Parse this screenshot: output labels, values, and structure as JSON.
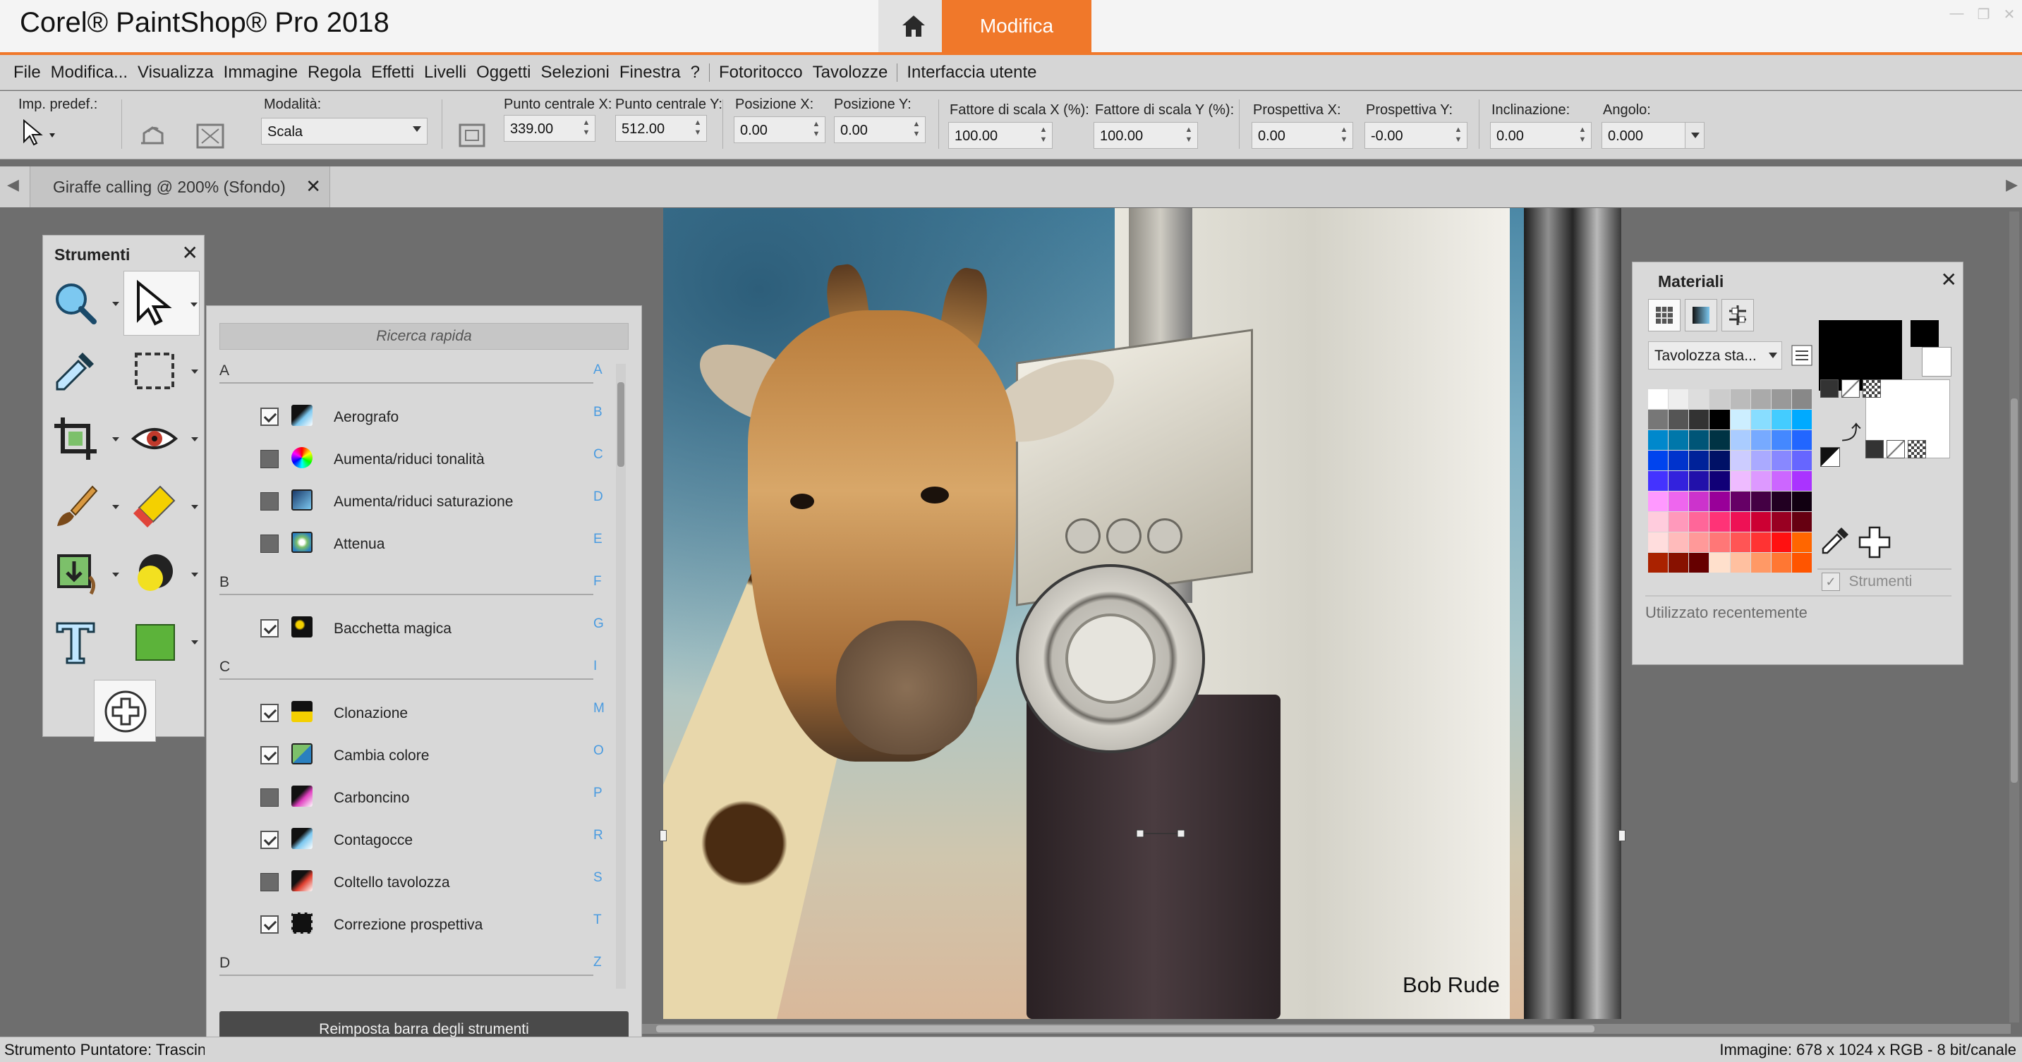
{
  "app": {
    "title": "Corel® PaintShop® Pro 2018",
    "workspace_tab": "Modifica"
  },
  "menu": [
    "File",
    "Modifica...",
    "Visualizza",
    "Immagine",
    "Regola",
    "Effetti",
    "Livelli",
    "Oggetti",
    "Selezioni",
    "Finestra",
    "?",
    "Fotoritocco",
    "Tavolozze",
    "Interfaccia utente"
  ],
  "tool_options": {
    "preset_label": "Imp. predef.:",
    "mode_label": "Modalità:",
    "mode_value": "Scala",
    "fields": [
      {
        "label": "Punto centrale X:",
        "value": "339.00"
      },
      {
        "label": "Punto centrale Y:",
        "value": "512.00"
      },
      {
        "label": "Posizione X:",
        "value": "0.00"
      },
      {
        "label": "Posizione Y:",
        "value": "0.00"
      },
      {
        "label": "Fattore di scala X (%):",
        "value": "100.00"
      },
      {
        "label": "Fattore di scala Y (%):",
        "value": "100.00"
      },
      {
        "label": "Prospettiva X:",
        "value": "0.00"
      },
      {
        "label": "Prospettiva Y:",
        "value": "-0.00"
      },
      {
        "label": "Inclinazione:",
        "value": "0.00"
      },
      {
        "label": "Angolo:",
        "value": "0.000"
      }
    ]
  },
  "document_tab": {
    "label": "Giraffe calling @ 200% (Sfondo)"
  },
  "tools_palette": {
    "title": "Strumenti"
  },
  "customize_panel": {
    "search_placeholder": "Ricerca rapida",
    "alphabet": [
      "A",
      "B",
      "C",
      "D",
      "E",
      "F",
      "G",
      "I",
      "M",
      "O",
      "P",
      "R",
      "S",
      "T",
      "Z"
    ],
    "sections": [
      {
        "letter": "A",
        "items": [
          {
            "label": "Aerografo",
            "checked": true
          },
          {
            "label": "Aumenta/riduci tonalità",
            "checked": false
          },
          {
            "label": "Aumenta/riduci saturazione",
            "checked": false
          },
          {
            "label": "Attenua",
            "checked": false
          }
        ]
      },
      {
        "letter": "B",
        "items": [
          {
            "label": "Bacchetta magica",
            "checked": true
          }
        ]
      },
      {
        "letter": "C",
        "items": [
          {
            "label": "Clonazione",
            "checked": true
          },
          {
            "label": "Cambia colore",
            "checked": true
          },
          {
            "label": "Carboncino",
            "checked": false
          },
          {
            "label": "Contagocce",
            "checked": true
          },
          {
            "label": "Coltello tavolozza",
            "checked": false
          },
          {
            "label": "Correzione prospettiva",
            "checked": true
          }
        ]
      },
      {
        "letter": "D",
        "items": []
      }
    ],
    "reset_button": "Reimposta barra degli strumenti"
  },
  "canvas": {
    "signature": "Bob Rude"
  },
  "materials": {
    "title": "Materiali",
    "swatch_dropdown": "Tavolozza sta...",
    "tools_checkbox": "Strumenti",
    "recent_label": "Utilizzato recentemente",
    "swatch_rows": [
      [
        "#ffffff",
        "#eeeeee",
        "#dddddd",
        "#cccccc",
        "#bbbbbb",
        "#aaaaaa",
        "#999999",
        "#888888"
      ],
      [
        "#777777",
        "#555555",
        "#333333",
        "#000000",
        "#cceeff",
        "#88ddff",
        "#44ccff",
        "#00aaff"
      ],
      [
        "#0088cc",
        "#0077aa",
        "#005577",
        "#003344",
        "#aaccff",
        "#77aaff",
        "#4488ff",
        "#2266ff"
      ],
      [
        "#0044ee",
        "#0033cc",
        "#002299",
        "#001166",
        "#ccccff",
        "#aaaaff",
        "#8888ff",
        "#6666ff"
      ],
      [
        "#4433ff",
        "#3322dd",
        "#2211aa",
        "#110077",
        "#eebbff",
        "#dd99ff",
        "#cc66ff",
        "#aa33ff"
      ],
      [
        "#ff99ff",
        "#ee66ee",
        "#cc33cc",
        "#990099",
        "#660066",
        "#440044",
        "#220022",
        "#110011"
      ],
      [
        "#ffccdd",
        "#ff99bb",
        "#ff6699",
        "#ff3377",
        "#ee1155",
        "#cc0033",
        "#990022",
        "#660011"
      ],
      [
        "#ffdddd",
        "#ffbbbb",
        "#ff9999",
        "#ff7777",
        "#ff5555",
        "#ff3333",
        "#ff1111",
        "#ff6600"
      ],
      [
        "#aa2200",
        "#881100",
        "#660000",
        "#ffe0cc",
        "#ffc0a0",
        "#ff9966",
        "#ff7733",
        "#ff5500"
      ]
    ]
  },
  "status": {
    "left": "Strumento Puntatore: Trascina",
    "right": "Immagine:  678 x 1024 x RGB - 8 bit/canale"
  },
  "colors": {
    "accent": "#f0782a",
    "panel": "#d8d8d8",
    "workspace": "#6e6e6e",
    "alpha_index": "#4a9be0"
  }
}
